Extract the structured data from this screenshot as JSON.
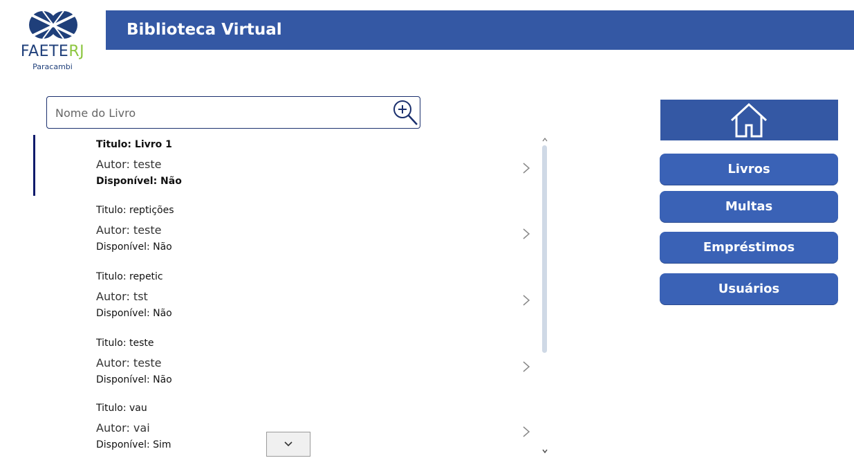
{
  "logo": {
    "brand_main": "FAETE",
    "brand_accent": "RJ",
    "subtitle": "Paracambi"
  },
  "header": {
    "title": "Biblioteca Virtual"
  },
  "search": {
    "placeholder": "Nome do Livro"
  },
  "books": [
    {
      "titulo": "Titulo: Livro 1",
      "autor": "Autor: teste",
      "disponivel": "Disponível: Não"
    },
    {
      "titulo": "Titulo: reptições",
      "autor": "Autor: teste",
      "disponivel": "Disponível: Não"
    },
    {
      "titulo": "Titulo: repetic",
      "autor": "Autor: tst",
      "disponivel": "Disponível: Não"
    },
    {
      "titulo": "Titulo: teste",
      "autor": "Autor: teste",
      "disponivel": "Disponível: Não"
    },
    {
      "titulo": "Titulo: vau",
      "autor": "Autor: vai",
      "disponivel": "Disponível: Sim"
    }
  ],
  "nav": {
    "livros": "Livros",
    "multas": "Multas",
    "emprestimos": "Empréstimos",
    "usuarios": "Usuários"
  },
  "colors": {
    "header": "#3458a4",
    "button": "#3a62b6",
    "accent": "#8cc63f",
    "logo_blue": "#1f3f7a"
  }
}
